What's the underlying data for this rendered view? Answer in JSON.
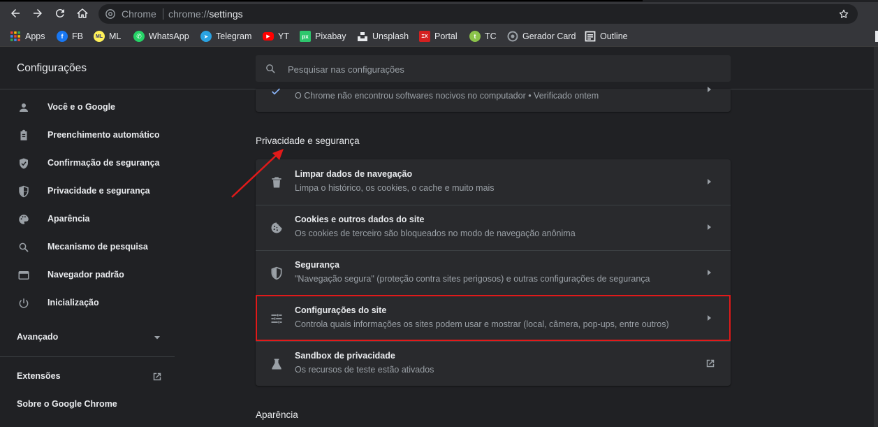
{
  "browser": {
    "site_name": "Chrome",
    "url_scheme": "chrome://",
    "url_path": "settings"
  },
  "bookmarks": [
    {
      "label": "Apps",
      "icon": "apps-grid-icon",
      "color": "#ea4335"
    },
    {
      "label": "FB",
      "icon": "facebook-icon",
      "color": "#1877f2"
    },
    {
      "label": "ML",
      "icon": "mercadolivre-icon",
      "color": "#fff159"
    },
    {
      "label": "WhatsApp",
      "icon": "whatsapp-icon",
      "color": "#25d366"
    },
    {
      "label": "Telegram",
      "icon": "telegram-icon",
      "color": "#2aa3e3"
    },
    {
      "label": "YT",
      "icon": "youtube-icon",
      "color": "#ff0000"
    },
    {
      "label": "Pixabay",
      "icon": "pixabay-icon",
      "color": "#2ec66d"
    },
    {
      "label": "Unsplash",
      "icon": "unsplash-icon",
      "color": "#000000"
    },
    {
      "label": "Portal",
      "icon": "portal-icon",
      "color": "#d42020"
    },
    {
      "label": "TC",
      "icon": "tc-icon",
      "color": "#8bc34a"
    },
    {
      "label": "Gerador Card",
      "icon": "gerador-card-icon",
      "color": "#9aa0a6"
    },
    {
      "label": "Outline",
      "icon": "outline-icon",
      "color": "#e8eaed"
    }
  ],
  "settings": {
    "title": "Configurações",
    "search_placeholder": "Pesquisar nas configurações"
  },
  "sidebar": {
    "items": [
      {
        "label": "Você e o Google",
        "icon": "person-icon"
      },
      {
        "label": "Preenchimento automático",
        "icon": "clipboard-icon"
      },
      {
        "label": "Confirmação de segurança",
        "icon": "shield-check-icon"
      },
      {
        "label": "Privacidade e segurança",
        "icon": "shield-half-icon"
      },
      {
        "label": "Aparência",
        "icon": "palette-icon"
      },
      {
        "label": "Mecanismo de pesquisa",
        "icon": "search-icon"
      },
      {
        "label": "Navegador padrão",
        "icon": "browser-window-icon"
      },
      {
        "label": "Inicialização",
        "icon": "power-icon"
      }
    ],
    "advanced": "Avançado",
    "extensions": "Extensões",
    "about": "Sobre o Google Chrome"
  },
  "main": {
    "safety_check_status": "O Chrome não encontrou softwares nocivos no computador • Verificado ontem",
    "privacy_section_title": "Privacidade e segurança",
    "privacy_rows": [
      {
        "title": "Limpar dados de navegação",
        "subtitle": "Limpa o histórico, os cookies, o cache e muito mais",
        "icon": "trash-icon"
      },
      {
        "title": "Cookies e outros dados do site",
        "subtitle": "Os cookies de terceiro são bloqueados no modo de navegação anônima",
        "icon": "cookie-icon"
      },
      {
        "title": "Segurança",
        "subtitle": "\"Navegação segura\" (proteção contra sites perigosos) e outras configurações de segurança",
        "icon": "shield-half-icon"
      },
      {
        "title": "Configurações do site",
        "subtitle": "Controla quais informações os sites podem usar e mostrar (local, câmera, pop-ups, entre outros)",
        "icon": "tune-sliders-icon"
      },
      {
        "title": "Sandbox de privacidade",
        "subtitle": "Os recursos de teste estão ativados",
        "icon": "flask-icon"
      }
    ],
    "appearance_section_title": "Aparência"
  },
  "colors": {
    "highlight": "#e11a1a",
    "page_bg": "#202124",
    "card_bg": "#292a2d",
    "toolbar_bg": "#35363a",
    "accent_blue": "#8ab4f8"
  }
}
